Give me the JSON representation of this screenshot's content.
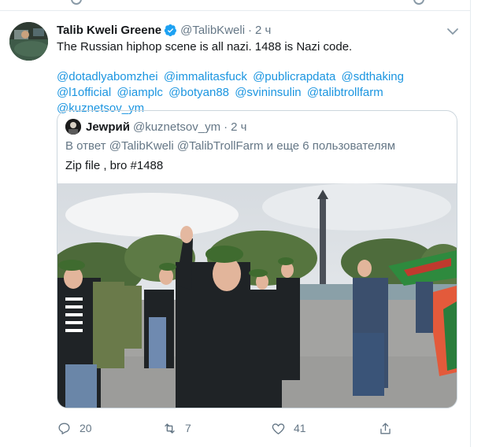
{
  "tweet": {
    "author_name": "Talib Kweli Greene",
    "author_handle": "@TalibKweli",
    "separator": "·",
    "timestamp": "2 ч",
    "text": "The Russian hiphop scene is all nazi. 1488 is Nazi code.",
    "mentions": [
      "@dotadlyabomzhei",
      "@immalitasfuck",
      "@publicrapdata",
      "@sdthaking",
      "@l1official",
      "@iamplc",
      "@botyan88",
      "@svininsulin",
      "@talibtrollfarm",
      "@kuznetsov_ym"
    ],
    "reply_count": "20",
    "retweet_count": "7",
    "like_count": "41"
  },
  "quoted": {
    "author_name": "Jеwрий",
    "author_handle": "@kuznetsov_ym",
    "separator": "·",
    "timestamp": "2 ч",
    "reply_context": "В ответ @TalibKweli @TalibTrollFarm и еще 6 пользователям",
    "text": "Zip file , bro #1488"
  },
  "colors": {
    "link": "#1b95e0",
    "secondary_text": "#657786",
    "verified": "#1da1f2"
  },
  "icons": [
    "verified-badge-icon",
    "chevron-down-icon",
    "reply-icon",
    "retweet-icon",
    "like-icon",
    "share-icon"
  ]
}
